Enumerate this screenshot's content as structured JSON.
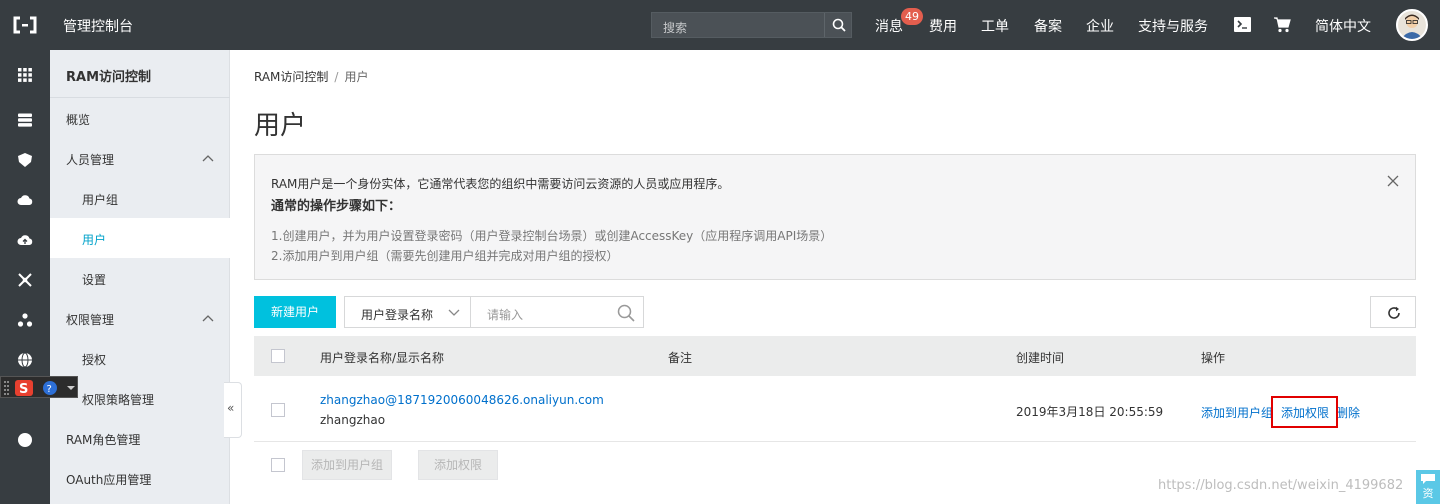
{
  "topbar": {
    "title": "管理控制台",
    "search_placeholder": "搜索",
    "messages_label": "消息",
    "messages_count": "49",
    "nav": [
      "费用",
      "工单",
      "备案",
      "企业",
      "支持与服务"
    ],
    "language": "简体中文",
    "icons": [
      "terminal-icon",
      "cart-icon"
    ]
  },
  "sidebar": {
    "title": "RAM访问控制",
    "items": {
      "overview": "概览",
      "people": "人员管理",
      "groups": "用户组",
      "users": "用户",
      "settings": "设置",
      "permissions": "权限管理",
      "grant": "授权",
      "policies": "权限策略管理",
      "roles": "RAM角色管理",
      "oauth": "OAuth应用管理"
    },
    "collapse_glyph": "«"
  },
  "breadcrumb": {
    "root": "RAM访问控制",
    "separator": "/",
    "current": "用户"
  },
  "page_title": "用户",
  "notice": {
    "line1": "RAM用户是一个身份实体，它通常代表您的组织中需要访问云资源的人员或应用程序。",
    "heading": "通常的操作步骤如下：",
    "step1": "1.创建用户，并为用户设置登录密码（用户登录控制台场景）或创建AccessKey（应用程序调用API场景）",
    "step2": "2.添加用户到用户组（需要先创建用户组并完成对用户组的授权）"
  },
  "toolbar": {
    "create_label": "新建用户",
    "filter_select": "用户登录名称",
    "input_placeholder": "请输入"
  },
  "table": {
    "headers": {
      "name": "用户登录名称/显示名称",
      "remark": "备注",
      "created": "创建时间",
      "actions": "操作"
    },
    "rows": [
      {
        "login": "zhangzhao@1871920060048626.onaliyun.com",
        "display": "zhangzhao",
        "remark": "",
        "created": "2019年3月18日 20:55:59",
        "actions": {
          "add_group": "添加到用户组",
          "add_perm": "添加权限",
          "delete": "删除"
        }
      }
    ],
    "footer": {
      "add_group": "添加到用户组",
      "add_perm": "添加权限"
    }
  },
  "watermark": "https://blog.csdn.net/weixin_4199682",
  "float_tab": "资",
  "colors": {
    "topbar": "#373d41",
    "accent": "#00c1de",
    "link": "#0070cc",
    "highlight": "#e10000",
    "badge": "#e35e4e"
  }
}
